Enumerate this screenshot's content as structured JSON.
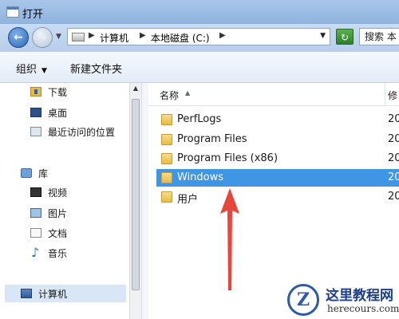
{
  "window": {
    "title": "打开"
  },
  "address_bar": {
    "crumbs": [
      "计算机",
      "本地磁盘 (C:)"
    ],
    "search_placeholder": "搜索 本"
  },
  "toolbar": {
    "organize_label": "组织",
    "new_folder_label": "新建文件夹"
  },
  "nav_pane": {
    "items": [
      {
        "label": "下载",
        "icon": "download-folder-icon"
      },
      {
        "label": "桌面",
        "icon": "desktop-icon"
      },
      {
        "label": "最近访问的位置",
        "icon": "recent-places-icon"
      },
      {
        "label": "库",
        "icon": "library-icon"
      },
      {
        "label": "视频",
        "icon": "video-icon"
      },
      {
        "label": "图片",
        "icon": "picture-icon"
      },
      {
        "label": "文档",
        "icon": "document-icon"
      },
      {
        "label": "音乐",
        "icon": "music-icon"
      },
      {
        "label": "计算机",
        "icon": "computer-icon"
      }
    ]
  },
  "file_list": {
    "columns": {
      "name": "名称",
      "modified": "修"
    },
    "rows": [
      {
        "name": "PerfLogs",
        "date": "20",
        "selected": false
      },
      {
        "name": "Program Files",
        "date": "20",
        "selected": false
      },
      {
        "name": "Program Files (x86)",
        "date": "20",
        "selected": false
      },
      {
        "name": "Windows",
        "date": "20",
        "selected": true
      },
      {
        "name": "用户",
        "date": "20",
        "selected": false
      }
    ]
  },
  "colors": {
    "selection": "#3f96e5",
    "arrow": "#e8453c"
  },
  "watermark": {
    "title": "这里教程网",
    "url": "herecours.com",
    "logo_letter": "Z"
  }
}
